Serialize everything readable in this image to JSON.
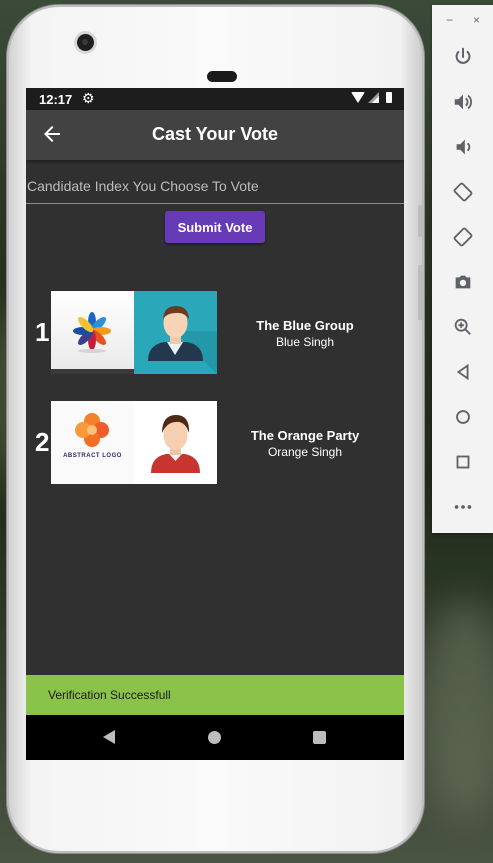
{
  "status_bar": {
    "time": "12:17"
  },
  "app_bar": {
    "title": "Cast Your Vote"
  },
  "vote_form": {
    "placeholder": "Candidate Index You Choose To Vote",
    "submit_label": "Submit Vote"
  },
  "candidates": [
    {
      "index": "1",
      "party": "The Blue Group",
      "name": "Blue Singh"
    },
    {
      "index": "2",
      "party": "The Orange Party",
      "name": "Orange Singh"
    }
  ],
  "logo_texts": {
    "orange_logo": "ABSTRACT LOGO"
  },
  "snackbar": {
    "message": "Verification Successfull"
  },
  "emulator_toolbar": {
    "items": [
      "power-icon",
      "volume-up-icon",
      "volume-down-icon",
      "rotate-left-icon",
      "rotate-right-icon",
      "camera-icon",
      "zoom-icon",
      "back-icon",
      "home-icon",
      "overview-icon",
      "more-icon"
    ],
    "minimize": "−",
    "close": "×"
  },
  "colors": {
    "accent_button": "#673ab7",
    "snackbar": "#8bc34a",
    "appbar": "#424242",
    "screen_bg": "#303030"
  }
}
